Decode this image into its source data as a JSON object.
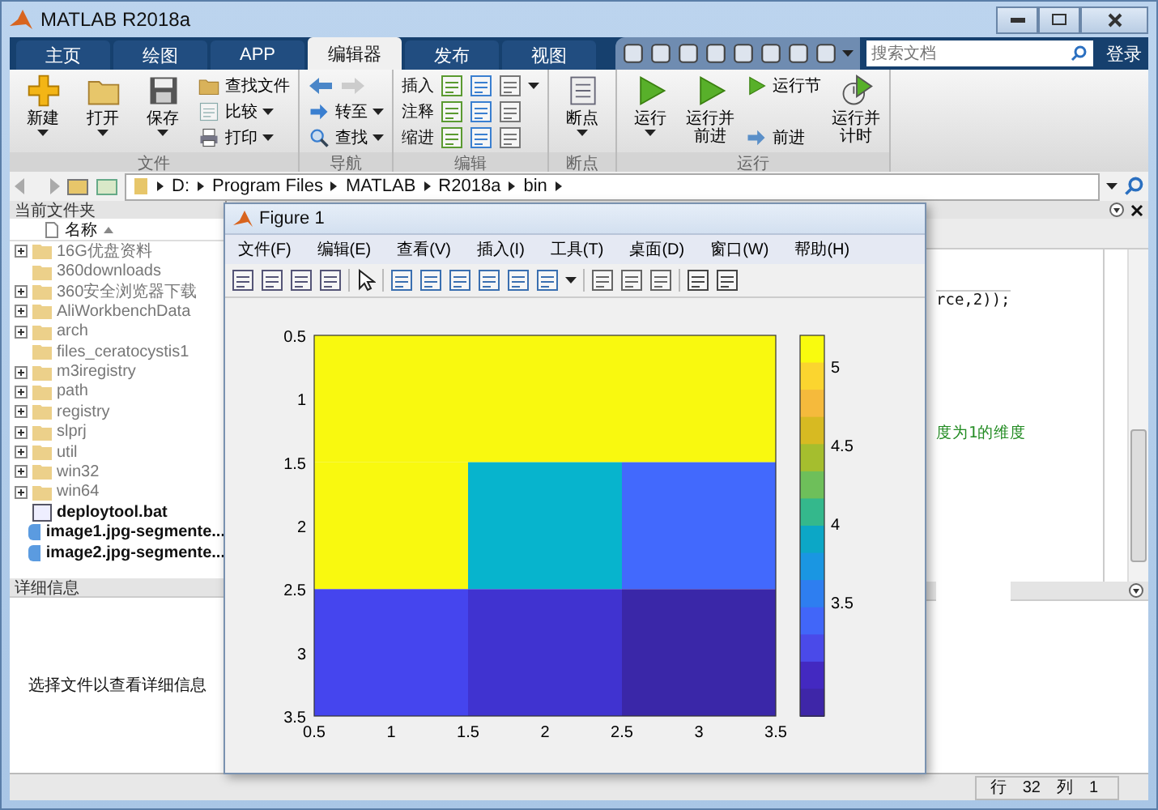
{
  "window": {
    "title": "MATLAB R2018a"
  },
  "tabs": [
    {
      "label": "主页",
      "selected": false
    },
    {
      "label": "绘图",
      "selected": false
    },
    {
      "label": "APP",
      "selected": false
    },
    {
      "label": "编辑器",
      "selected": true
    },
    {
      "label": "发布",
      "selected": false
    },
    {
      "label": "视图",
      "selected": false
    }
  ],
  "search": {
    "placeholder": "搜索文档"
  },
  "login": "登录",
  "ribbon": [
    {
      "label": "文件",
      "columns": [
        [
          {
            "label": "新建",
            "kind": "large",
            "dropdown": true
          }
        ],
        [
          {
            "label": "打开",
            "kind": "large",
            "dropdown": true
          }
        ],
        [
          {
            "label": "保存",
            "kind": "large",
            "dropdown": true
          }
        ],
        [
          {
            "label": "查找文件",
            "kind": "small",
            "dropdown": false
          },
          {
            "label": "比较",
            "kind": "small",
            "dropdown": true
          },
          {
            "label": "打印",
            "kind": "small",
            "dropdown": true
          }
        ]
      ]
    },
    {
      "label": "导航",
      "columns": [
        [
          {
            "kind": "arrows"
          },
          {
            "label": "转至",
            "kind": "small",
            "dropdown": true
          },
          {
            "label": "查找",
            "kind": "small",
            "dropdown": true
          }
        ]
      ]
    },
    {
      "label": "编辑",
      "columns": [
        [
          {
            "label": "插入",
            "kind": "row",
            "dropdown": true
          },
          {
            "label": "注释",
            "kind": "row",
            "dropdown": false
          },
          {
            "label": "缩进",
            "kind": "row",
            "dropdown": false
          }
        ]
      ]
    },
    {
      "label": "断点",
      "columns": [
        [
          {
            "label": "断点",
            "kind": "large",
            "dropdown": true
          }
        ]
      ]
    },
    {
      "label": "运行",
      "columns": [
        [
          {
            "label": "运行",
            "kind": "large",
            "dropdown": true
          }
        ],
        [
          {
            "label": "运行并前进",
            "kind": "large",
            "dropdown": false
          }
        ],
        [
          {
            "label": "运行节",
            "kind": "small",
            "dropdown": false
          },
          {
            "label": "前进",
            "kind": "small",
            "dropdown": false
          }
        ],
        [
          {
            "label": "运行并计时",
            "kind": "large",
            "dropdown": false
          }
        ]
      ]
    }
  ],
  "address": [
    "D:",
    "Program Files",
    "MATLAB",
    "R2018a",
    "bin"
  ],
  "folder_panel": {
    "title": "当前文件夹",
    "column": "名称",
    "files": [
      {
        "name": "16G优盘资料",
        "kind": "folder",
        "expandable": true
      },
      {
        "name": "360downloads",
        "kind": "folder",
        "expandable": false
      },
      {
        "name": "360安全浏览器下载",
        "kind": "folder",
        "expandable": true
      },
      {
        "name": "AliWorkbenchData",
        "kind": "folder",
        "expandable": true
      },
      {
        "name": "arch",
        "kind": "folder",
        "expandable": true
      },
      {
        "name": "files_ceratocystis1",
        "kind": "folder",
        "expandable": false
      },
      {
        "name": "m3iregistry",
        "kind": "folder",
        "expandable": true
      },
      {
        "name": "path",
        "kind": "folder",
        "expandable": true
      },
      {
        "name": "registry",
        "kind": "folder",
        "expandable": true
      },
      {
        "name": "slprj",
        "kind": "folder",
        "expandable": true
      },
      {
        "name": "util",
        "kind": "folder",
        "expandable": true
      },
      {
        "name": "win32",
        "kind": "folder",
        "expandable": true
      },
      {
        "name": "win64",
        "kind": "folder",
        "expandable": true
      },
      {
        "name": "deploytool.bat",
        "kind": "script",
        "expandable": false
      },
      {
        "name": "image1.jpg-segmente...",
        "kind": "image",
        "expandable": false
      },
      {
        "name": "image2.jpg-segmente...",
        "kind": "image",
        "expandable": false
      }
    ]
  },
  "details_panel": {
    "title": "详细信息",
    "message": "选择文件以查看详细信息"
  },
  "editor": {
    "lines": [
      {
        "text": "rce,2));",
        "kind": "code"
      },
      {
        "text": "度为1的维度",
        "kind": "comment"
      }
    ]
  },
  "status_bar": {
    "row_label": "行",
    "row": "32",
    "col_label": "列",
    "col": "1"
  },
  "figure": {
    "title": "Figure 1",
    "menu": [
      "文件(F)",
      "编辑(E)",
      "查看(V)",
      "插入(I)",
      "工具(T)",
      "桌面(D)",
      "窗口(W)",
      "帮助(H)"
    ],
    "plot": {
      "xticks": [
        "0.5",
        "1",
        "1.5",
        "2",
        "2.5",
        "3",
        "3.5"
      ],
      "yticks": [
        "0.5",
        "1",
        "1.5",
        "2",
        "2.5",
        "3",
        "3.5"
      ],
      "colorbar_ticks": [
        "5",
        "4.5",
        "4",
        "3.5"
      ],
      "cells": [
        [
          {
            "color": "#f9f90f"
          },
          {
            "color": "#f9f90f"
          },
          {
            "color": "#f9f90f"
          }
        ],
        [
          {
            "color": "#f9f90f"
          },
          {
            "color": "#07b4cd"
          },
          {
            "color": "#4269fd"
          }
        ],
        [
          {
            "color": "#4545ee"
          },
          {
            "color": "#4033d0"
          },
          {
            "color": "#3a27a8"
          }
        ]
      ]
    }
  }
}
